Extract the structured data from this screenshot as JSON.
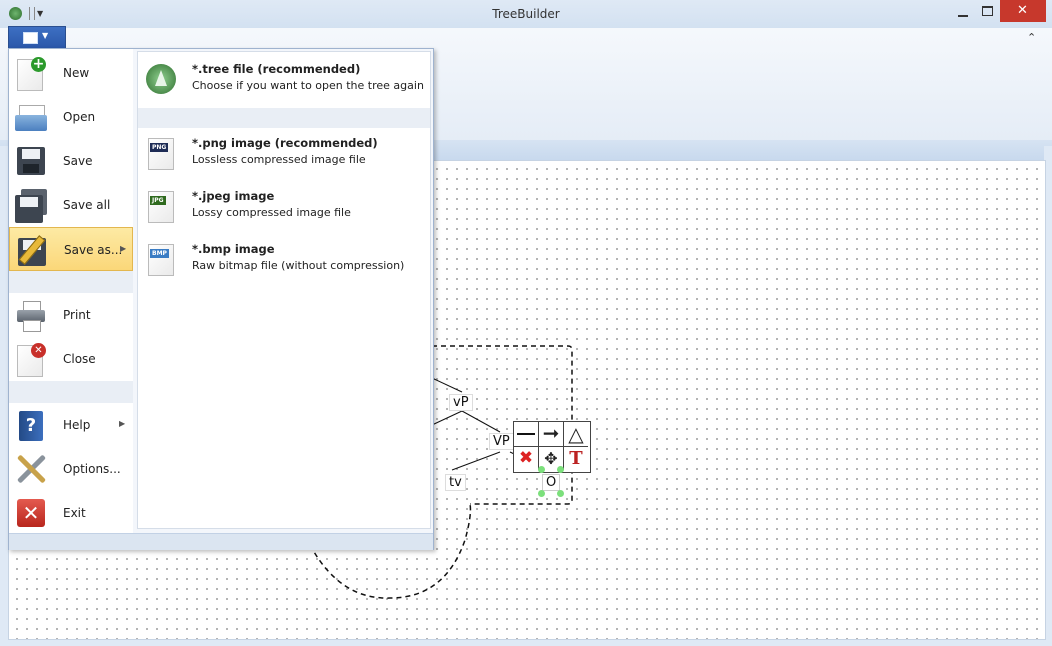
{
  "window": {
    "title": "TreeBuilder",
    "minimize_label": "▭",
    "maximize_label": "□",
    "close_label": "✕",
    "collapse_ribbon_label": "⌃"
  },
  "app_menu": {
    "items": [
      {
        "label": "New",
        "icon": "new-document-icon"
      },
      {
        "label": "Open",
        "icon": "open-folder-icon"
      },
      {
        "label": "Save",
        "icon": "floppy-disk-icon"
      },
      {
        "label": "Save all",
        "icon": "floppy-disks-icon"
      },
      {
        "label": "Save as...",
        "icon": "save-as-pencil-icon",
        "selected": true,
        "has_submenu": true
      },
      {
        "label": "Print",
        "icon": "printer-icon"
      },
      {
        "label": "Close",
        "icon": "close-document-icon"
      },
      {
        "label": "Help",
        "icon": "help-book-icon",
        "has_submenu": true
      },
      {
        "label": "Options...",
        "icon": "tools-icon"
      },
      {
        "label": "Exit",
        "icon": "exit-icon"
      }
    ]
  },
  "save_as_submenu": {
    "items": [
      {
        "title": "*.tree file (recommended)",
        "desc": "Choose if you want to open the tree again",
        "icon": "tree-file-icon"
      },
      {
        "title": "*.png image (recommended)",
        "desc": "Lossless compressed image file",
        "icon": "png-file-icon",
        "tag": "PNG"
      },
      {
        "title": "*.jpeg image",
        "desc": "Lossy compressed image file",
        "icon": "jpeg-file-icon",
        "tag": "JPG"
      },
      {
        "title": "*.bmp image",
        "desc": "Raw bitmap file (without compression)",
        "icon": "bmp-file-icon",
        "tag": "BMP"
      }
    ]
  },
  "tree": {
    "nodes": [
      "vP",
      "VP",
      "tv",
      "O"
    ],
    "toolbar_text_icon": "T"
  },
  "colors": {
    "accent": "#2a57a8",
    "selected_item": "#fbd779",
    "close_button": "#c7382c",
    "handle": "#7ce07c"
  }
}
